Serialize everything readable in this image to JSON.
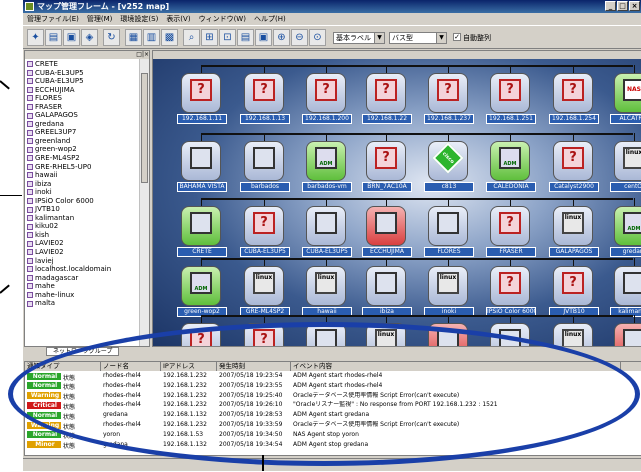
{
  "window": {
    "title": "マップ管理フレーム - [v252 map]"
  },
  "menu": [
    "管理ファイル(E)",
    "管理(M)",
    "環境設定(S)",
    "表示(V)",
    "ウィンドウ(W)",
    "ヘルプ(H)"
  ],
  "toolbar": {
    "label_select": "基本ラベル",
    "shape_select": "バス型",
    "auto_arrange": "自動整列"
  },
  "tree": {
    "items": [
      "CRETE",
      "CUBA-EL3UP5",
      "CUBA-EL3UP5",
      "ECCHUJIMA",
      "FLORES",
      "FRASER",
      "GALAPAGOS",
      "gredana",
      "GREEL3UP7",
      "greenland",
      "green-wop2",
      "GRE-ML4SP2",
      "GRE-RHEL5-UP0",
      "hawaii",
      "ibiza",
      "inoki",
      "IPSiO Color 6000",
      "JVTB10",
      "kalimantan",
      "kiku02",
      "kish",
      "LAVIE02",
      "LAVIE02",
      "laviej",
      "localhost.localdomain",
      "madagascar",
      "mahe",
      "mahe-linux",
      "malta"
    ],
    "tab_label": "ネットワークグループ"
  },
  "map": {
    "row1": [
      {
        "label": "192.168.1.11",
        "kind": "q"
      },
      {
        "label": "192.168.1.13",
        "kind": "q"
      },
      {
        "label": "192.168.1.200",
        "kind": "q"
      },
      {
        "label": "192.168.1.22",
        "kind": "q"
      },
      {
        "label": "192.168.1.237",
        "kind": "q"
      },
      {
        "label": "192.168.1.251",
        "kind": "q"
      },
      {
        "label": "192.168.1.254",
        "kind": "q"
      },
      {
        "label": "ALCATRAZ",
        "kind": "nas"
      }
    ],
    "row2": [
      {
        "label": "BAHAMA VISTA",
        "kind": "srv"
      },
      {
        "label": "barbados",
        "kind": "srv"
      },
      {
        "label": "barbados-vm",
        "kind": "adm"
      },
      {
        "label": "BRN_7AC10A",
        "kind": "q"
      },
      {
        "label": "c813",
        "kind": "cisco"
      },
      {
        "label": "CALEDONIA",
        "kind": "adm"
      },
      {
        "label": "Catalyst2900",
        "kind": "q"
      },
      {
        "label": "centOS",
        "kind": "linux"
      }
    ],
    "row3": [
      {
        "label": "CRETE",
        "kind": "green"
      },
      {
        "label": "CUBA-EL3UP5",
        "kind": "q"
      },
      {
        "label": "CUBA-EL3UP5",
        "kind": "srv"
      },
      {
        "label": "ECCHUJIMA",
        "kind": "red"
      },
      {
        "label": "FLORES",
        "kind": "srv"
      },
      {
        "label": "FRASER",
        "kind": "q"
      },
      {
        "label": "GALAPAGOS",
        "kind": "linux"
      },
      {
        "label": "gredana",
        "kind": "adm"
      }
    ],
    "row4": [
      {
        "label": "green-wop2",
        "kind": "adm"
      },
      {
        "label": "GRE-ML4SP2",
        "kind": "linux"
      },
      {
        "label": "hawaii",
        "kind": "linux"
      },
      {
        "label": "ibiza",
        "kind": "srv"
      },
      {
        "label": "inoki",
        "kind": "linux"
      },
      {
        "label": "IPSiO Color 6000",
        "kind": "q"
      },
      {
        "label": "JVTB10",
        "kind": "q"
      },
      {
        "label": "kalimantan",
        "kind": "srv"
      }
    ],
    "row5": [
      {
        "label": "LAVIE02",
        "kind": "q"
      },
      {
        "label": "LAVIE02",
        "kind": "q"
      },
      {
        "label": "laviej",
        "kind": "srv"
      },
      {
        "label": "localhost.localdomain",
        "kind": "linux"
      },
      {
        "label": "madagascar",
        "kind": "red"
      },
      {
        "label": "mahe",
        "kind": "srv"
      },
      {
        "label": "mahe-linux",
        "kind": "linux"
      },
      {
        "label": "malta",
        "kind": "red"
      }
    ],
    "icon_text": {
      "q": "?",
      "linux": "linux",
      "nas": "NAS",
      "adm": "ADM",
      "cisco": "cisco"
    }
  },
  "events": {
    "headers": [
      "通知タイプ",
      "ノード名",
      "IPアドレス",
      "発生時刻",
      "イベント内容"
    ],
    "rows": [
      {
        "severity": "Normal",
        "color": "#2aa52a",
        "status": "状態",
        "node": "rhodes-rhel4",
        "ip": "192.168.1.232",
        "time": "2007/05/18 19:23:54",
        "msg": "ADM Agent start rhodes-rhel4"
      },
      {
        "severity": "Normal",
        "color": "#2aa52a",
        "status": "状態",
        "node": "rhodes-rhel4",
        "ip": "192.168.1.232",
        "time": "2007/05/18 19:23:55",
        "msg": "ADM Agent start rhodes-rhel4"
      },
      {
        "severity": "Warning",
        "color": "#e0a000",
        "status": "状態",
        "node": "rhodes-rhel4",
        "ip": "192.168.1.232",
        "time": "2007/05/18 19:25:40",
        "msg": "Oracleデータベース使用率情報 Script Error(can't execute)"
      },
      {
        "severity": "Critical",
        "color": "#d01818",
        "status": "状態",
        "node": "rhodes-rhel4",
        "ip": "192.168.1.232",
        "time": "2007/05/18 19:26:10",
        "msg": "\"Oracleリスナー監視\" : No response from PORT 192.168.1.232 : 1521"
      },
      {
        "severity": "Normal",
        "color": "#2aa52a",
        "status": "状態",
        "node": "gredana",
        "ip": "192.168.1.132",
        "time": "2007/05/18 19:28:53",
        "msg": "ADM Agent start gredana"
      },
      {
        "severity": "Warning",
        "color": "#e0a000",
        "status": "状態",
        "node": "rhodes-rhel4",
        "ip": "192.168.1.232",
        "time": "2007/05/18 19:33:59",
        "msg": "Oracleデータベース使用率情報 Script Error(can't execute)"
      },
      {
        "severity": "Normal",
        "color": "#2aa52a",
        "status": "状態",
        "node": "yoron",
        "ip": "192.168.1.53",
        "time": "2007/05/18 19:34:50",
        "msg": "NAS Agent stop yoron"
      },
      {
        "severity": "Minor",
        "color": "#e0a000",
        "status": "状態",
        "node": "gredana",
        "ip": "192.168.1.132",
        "time": "2007/05/18 19:34:54",
        "msg": "ADM Agent stop gredana"
      }
    ]
  },
  "colors": {
    "title_bar": "#0a246a",
    "window_bg": "#d4d0c8",
    "label_bg": "#2a5db0",
    "annotation": "#1a3fa8"
  }
}
